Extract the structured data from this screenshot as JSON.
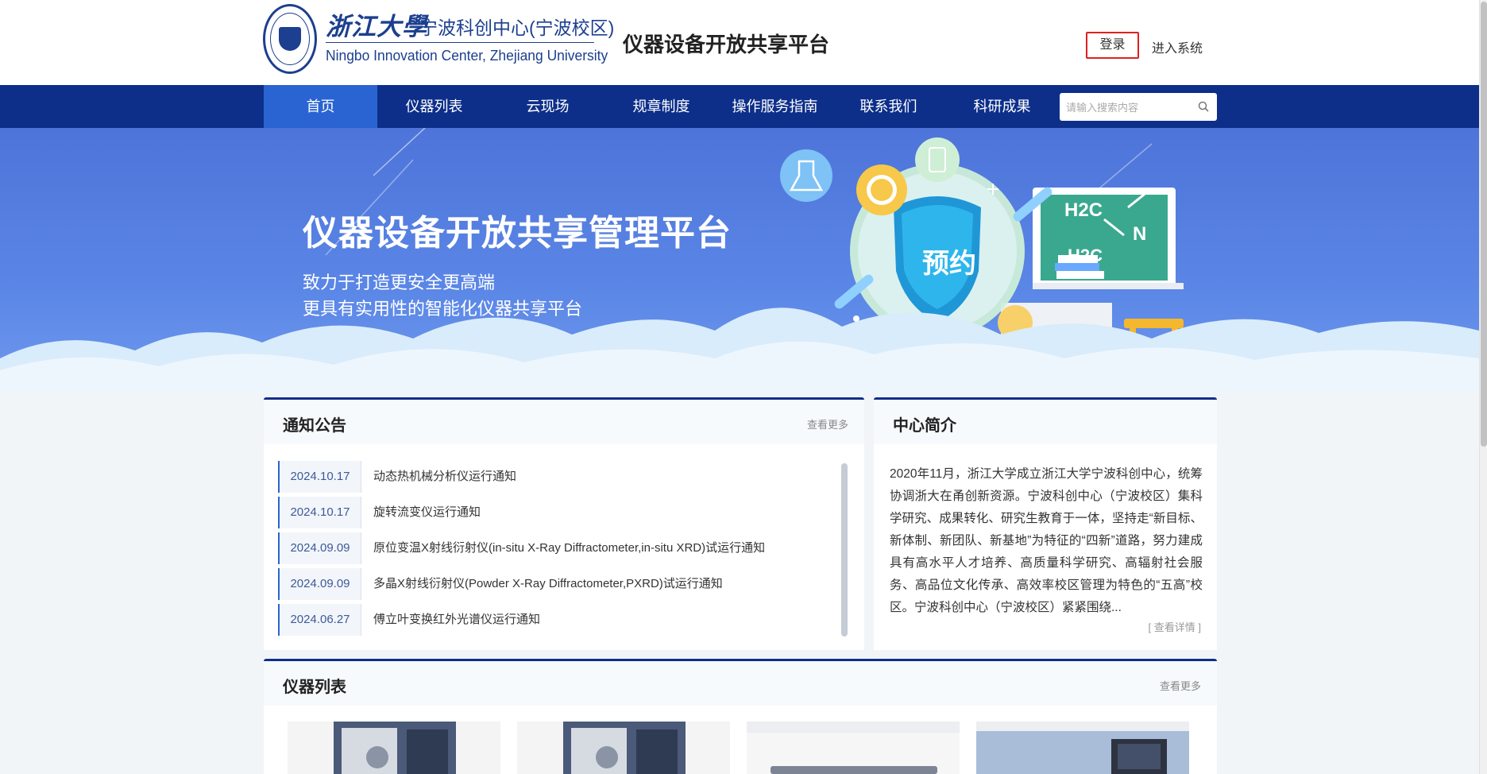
{
  "header": {
    "logo_title": "浙江大學",
    "logo_sub_cn": "宁波科创中心(宁波校区)",
    "logo_en": "Ningbo Innovation Center, Zhejiang University",
    "platform_title": "仪器设备开放共享平台",
    "login_label": "登录",
    "enter_system_label": "进入系统"
  },
  "nav": {
    "items": [
      {
        "label": "首页",
        "active": true
      },
      {
        "label": "仪器列表"
      },
      {
        "label": "云现场"
      },
      {
        "label": "规章制度"
      },
      {
        "label": "操作服务指南"
      },
      {
        "label": "联系我们"
      },
      {
        "label": "科研成果"
      }
    ],
    "search_placeholder": "请输入搜索内容",
    "colors": {
      "bar": "#0d2f8a",
      "active": "#2a64d2"
    }
  },
  "banner": {
    "title": "仪器设备开放共享管理平台",
    "line1": "致力于打造更安全更高端",
    "line2": "更具有实用性的智能化仪器共享平台",
    "shield_text": "预约",
    "board_text_1": "H2C",
    "board_text_2": "N",
    "board_text_3": "H2C"
  },
  "notices": {
    "title": "通知公告",
    "more_label": "查看更多",
    "items": [
      {
        "date": "2024.10.17",
        "text": "动态热机械分析仪运行通知"
      },
      {
        "date": "2024.10.17",
        "text": "旋转流变仪运行通知"
      },
      {
        "date": "2024.09.09",
        "text": "原位变温X射线衍射仪(in-situ X-Ray Diffractometer,in-situ XRD)试运行通知"
      },
      {
        "date": "2024.09.09",
        "text": "多晶X射线衍射仪(Powder X-Ray Diffractometer,PXRD)试运行通知"
      },
      {
        "date": "2024.06.27",
        "text": "傅立叶变换红外光谱仪运行通知"
      }
    ]
  },
  "intro": {
    "title": "中心简介",
    "text": "2020年11月，浙江大学成立浙江大学宁波科创中心，统筹协调浙大在甬创新资源。宁波科创中心（宁波校区）集科学研究、成果转化、研究生教育于一体，坚持走“新目标、新体制、新团队、新基地”为特征的“四新”道路，努力建成具有高水平人才培养、高质量科学研究、高辐射社会服务、高品位文化传承、高效率校区管理为特色的“五高”校区。宁波科创中心（宁波校区）紧紧围绕...",
    "more_label": "[ 查看详情 ]"
  },
  "instruments": {
    "title": "仪器列表",
    "more_label": "查看更多"
  },
  "theme": {
    "accent": "#0d2f8a",
    "highlight": "#e02020"
  }
}
